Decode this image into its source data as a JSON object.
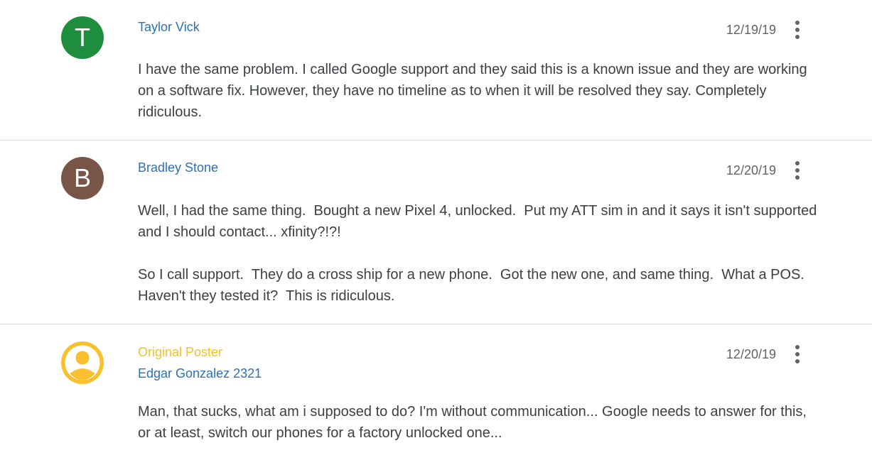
{
  "posts": [
    {
      "avatar_letter": "T",
      "avatar_color": "#1e8e3e",
      "author": "Taylor Vick",
      "date": "12/19/19",
      "paragraphs": [
        "I have the same problem. I called Google support and they said this is a known issue and they are working on a software fix. However, they have no timeline as to when it will be resolved they say. Completely ridiculous."
      ]
    },
    {
      "avatar_letter": "B",
      "avatar_color": "#795548",
      "author": "Bradley Stone",
      "date": "12/20/19",
      "paragraphs": [
        "Well, I had the same thing.  Bought a new Pixel 4, unlocked.  Put my ATT sim in and it says it isn't supported and I should contact... xfinity?!?!",
        "So I call support.  They do a cross ship for a new phone.  Got the new one, and same thing.  What a POS.  Haven't they tested it?  This is ridiculous."
      ]
    },
    {
      "avatar_icon": "account-circle-icon",
      "avatar_color": "#fbc02d",
      "op_label": "Original Poster",
      "author": "Edgar Gonzalez 2321",
      "date": "12/20/19",
      "paragraphs": [
        "Man, that sucks, what am i supposed to do? I'm without communication... Google needs to answer for this, or at least, switch our phones for a factory unlocked one..."
      ]
    }
  ],
  "colors": {
    "author_link": "#2f6fb7",
    "op_label": "#f2c12e",
    "divider": "#dadce0"
  }
}
